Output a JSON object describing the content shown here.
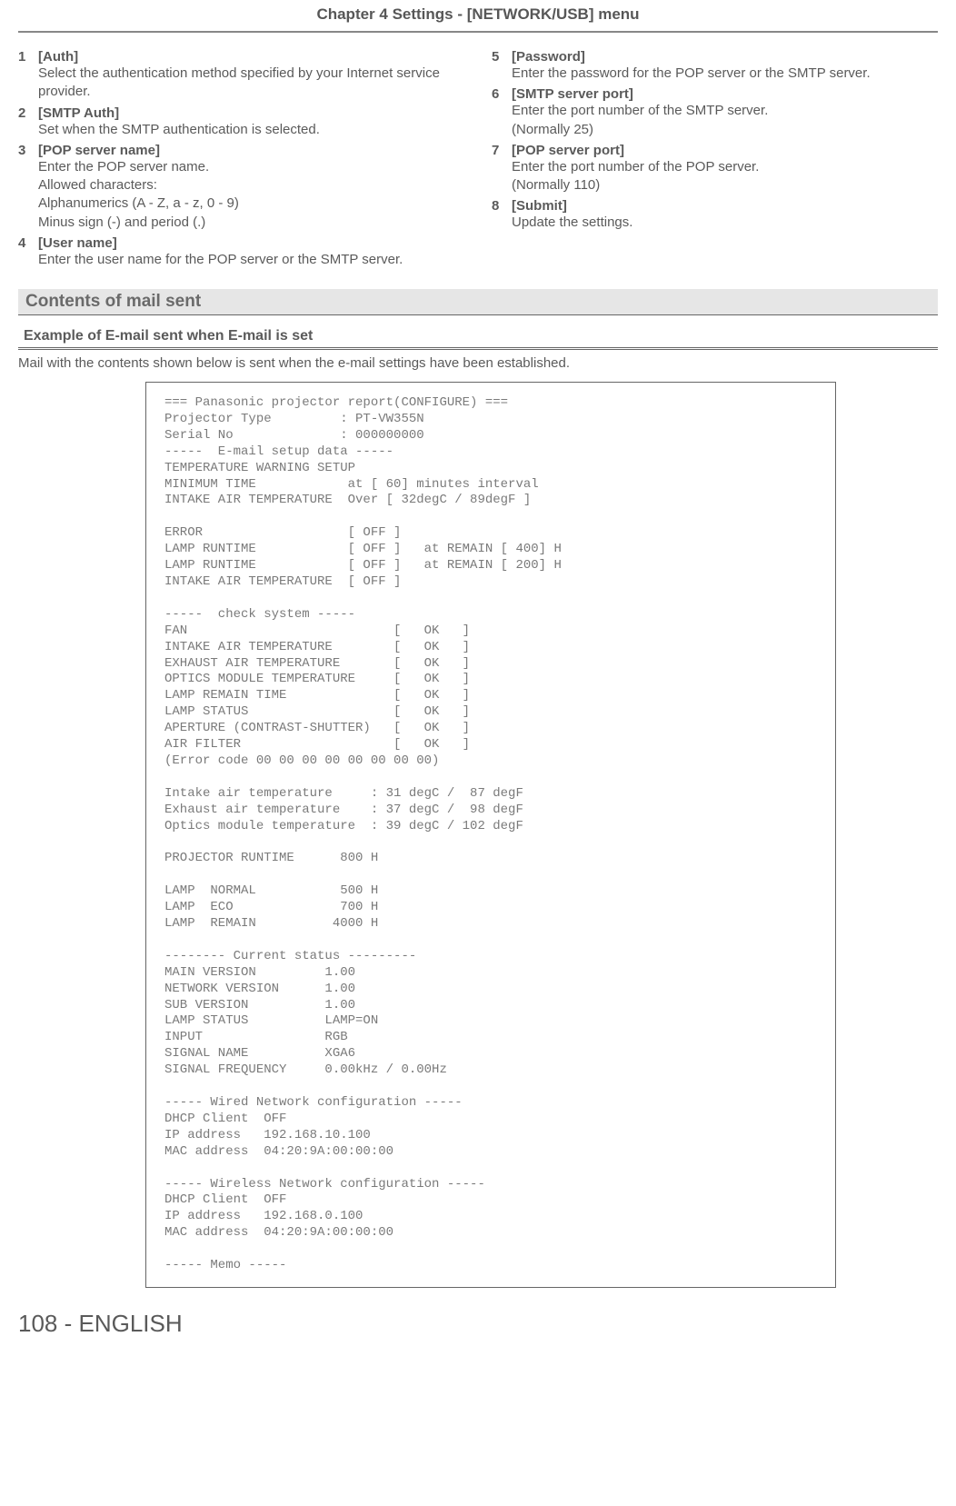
{
  "chapter": "Chapter 4   Settings - [NETWORK/USB] menu",
  "left_items": [
    {
      "num": "1",
      "title": "[Auth]",
      "desc": "Select the authentication method specified by your Internet service provider."
    },
    {
      "num": "2",
      "title": "[SMTP Auth]",
      "desc": "Set when the SMTP authentication is selected."
    },
    {
      "num": "3",
      "title": "[POP server name]",
      "desc": "Enter the POP server name.\nAllowed characters:\nAlphanumerics (A - Z, a - z, 0 - 9)\nMinus sign (-) and period (.)"
    },
    {
      "num": "4",
      "title": "[User name]",
      "desc": "Enter the user name for the POP server or the SMTP server."
    }
  ],
  "right_items": [
    {
      "num": "5",
      "title": "[Password]",
      "desc": "Enter the password for the POP server or the SMTP server."
    },
    {
      "num": "6",
      "title": "[SMTP server port]",
      "desc": "Enter the port number of the SMTP server.\n(Normally 25)"
    },
    {
      "num": "7",
      "title": "[POP server port]",
      "desc": "Enter the port number of the POP server.\n(Normally 110)"
    },
    {
      "num": "8",
      "title": "[Submit]",
      "desc": "Update the settings."
    }
  ],
  "section_heading": "Contents of mail sent",
  "subsection_heading": "Example of E-mail sent when E-mail is set",
  "lead_text": "Mail with the contents shown below is sent when the e-mail settings have been established.",
  "email_body": "=== Panasonic projector report(CONFIGURE) ===\nProjector Type         : PT-VW355N\nSerial No              : 000000000\n-----  E-mail setup data -----\nTEMPERATURE WARNING SETUP \nMINIMUM TIME            at [ 60] minutes interval \nINTAKE AIR TEMPERATURE  Over [ 32degC / 89degF ] \n\nERROR                   [ OFF ] \nLAMP RUNTIME            [ OFF ]   at REMAIN [ 400] H \nLAMP RUNTIME            [ OFF ]   at REMAIN [ 200] H \nINTAKE AIR TEMPERATURE  [ OFF ] \n\n-----  check system -----\nFAN                           [   OK   ]\nINTAKE AIR TEMPERATURE        [   OK   ]\nEXHAUST AIR TEMPERATURE       [   OK   ]\nOPTICS MODULE TEMPERATURE     [   OK   ]\nLAMP REMAIN TIME              [   OK   ]\nLAMP STATUS                   [   OK   ]\nAPERTURE (CONTRAST-SHUTTER)   [   OK   ]\nAIR FILTER                    [   OK   ]\n(Error code 00 00 00 00 00 00 00 00)\n\nIntake air temperature     : 31 degC /  87 degF\nExhaust air temperature    : 37 degC /  98 degF\nOptics module temperature  : 39 degC / 102 degF\n\nPROJECTOR RUNTIME      800 H\n\nLAMP  NORMAL           500 H\nLAMP  ECO              700 H\nLAMP  REMAIN          4000 H\n\n-------- Current status ---------\nMAIN VERSION         1.00\nNETWORK VERSION      1.00\nSUB VERSION          1.00\nLAMP STATUS          LAMP=ON\nINPUT                RGB\nSIGNAL NAME          XGA6\nSIGNAL FREQUENCY     0.00kHz / 0.00Hz\n\n----- Wired Network configuration -----\nDHCP Client  OFF \nIP address   192.168.10.100\nMAC address  04:20:9A:00:00:00\n\n----- Wireless Network configuration -----\nDHCP Client  OFF \nIP address   192.168.0.100\nMAC address  04:20:9A:00:00:00\n\n----- Memo -----",
  "page_footer": "108 - ENGLISH"
}
